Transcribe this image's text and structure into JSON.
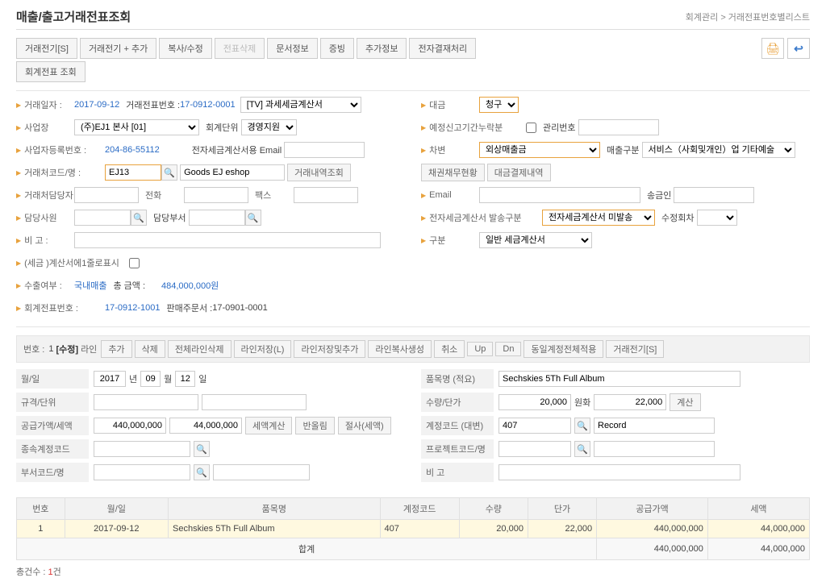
{
  "header": {
    "title": "매출/출고거래전표조회",
    "breadcrumb": "회계관리 > 거래전표번호별리스트"
  },
  "toolbar": {
    "buttons": [
      "거래전기[S]",
      "거래전기 + 추가",
      "복사/수정",
      "전표삭제",
      "문서정보",
      "증빙",
      "추가정보",
      "전자결재처리"
    ],
    "row2": [
      "회계전표 조회"
    ],
    "disabledIdx": 3
  },
  "form": {
    "거래일자_lbl": "거래일자 :",
    "거래일자": "2017-09-12",
    "거래전표번호_lbl": "거래전표번호 :",
    "거래전표번호": "17-0912-0001",
    "docType": "[TV] 과세세금계산서",
    "사업장_lbl": "사업장",
    "사업장": "(주)EJ1 본사 [01]",
    "회계단위_lbl": "회계단위",
    "회계단위": "경영지원",
    "사업자등록번호_lbl": "사업자등록번호 :",
    "사업자등록번호": "204-86-55112",
    "전자세금계산서용Email_lbl": "전자세금계산서용 Email",
    "거래처코드명_lbl": "거래처코드/명 :",
    "거래처코드": "EJ13",
    "거래처명": "Goods EJ eshop",
    "거래내역조회_btn": "거래내역조회",
    "거래처담당자_lbl": "거래처담당자",
    "전화_lbl": "전화",
    "팩스_lbl": "팩스",
    "담당사원_lbl": "담당사원",
    "담당부서_lbl": "담당부서",
    "비고_lbl": "비 고 :",
    "세금계산서표시_lbl": "(세금 )계산서에1줄로표시",
    "수출여부_lbl": "수출여부 :",
    "수출여부": "국내매출",
    "총금액_lbl": "총 금액 :",
    "총금액": "484,000,000원",
    "회계전표번호_lbl": "회계전표번호 :",
    "회계전표번호": "17-0912-1001",
    "판매주문서_lbl": "판매주문서 :",
    "판매주문서": "17-0901-0001",
    "대금_lbl": "대금",
    "대금": "청구",
    "예정신고기간누락분_lbl": "예정신고기간누락분",
    "관리번호_lbl": "관리번호",
    "차변_lbl": "차변",
    "차변": "외상매출금",
    "매출구분_lbl": "매출구분",
    "매출구분": "서비스（사회및개인）업  기타예술",
    "채권채무현황_btn": "채권채무현황",
    "대금결제내역_btn": "대금결제내역",
    "Email_lbl": "Email",
    "송금인_lbl": "송금인",
    "전자세금계산서발송구분_lbl": "전자세금계산서 발송구분",
    "전자발송": "전자세금계산서 미발송",
    "수정회차_lbl": "수정회차",
    "구분_lbl": "구분",
    "구분": "일반 세금계산서"
  },
  "section": {
    "번호_lbl": "번호 :",
    "번호": "1",
    "수정": "[수정]",
    "라인_lbl": "라인",
    "buttons": [
      "추가",
      "삭제",
      "전체라인삭제",
      "라인저장(L)",
      "라인저장및추가",
      "라인복사생성",
      "취소",
      "Up",
      "Dn",
      "동일계정전체적용",
      "거래전기[S]"
    ]
  },
  "detail": {
    "월일_lbl": "월/일",
    "년": "2017",
    "년_suf": "년",
    "월": "09",
    "월_suf": "월",
    "일": "12",
    "일_suf": "일",
    "규격단위_lbl": "규격/단위",
    "공급가액세액_lbl": "공급가액/세액",
    "공급가액": "440,000,000",
    "세액": "44,000,000",
    "세액계산_btn": "세액계산",
    "반올림_btn": "반올림",
    "절사_btn": "절사(세액)",
    "종속계정코드_lbl": "종속계정코드",
    "부서코드명_lbl": "부서코드/명",
    "품목명_lbl": "품목명 (적요)",
    "품목명": "Sechskies 5Th Full Album",
    "수량단가_lbl": "수량/단가",
    "수량": "20,000",
    "원화_lbl": "원화",
    "단가": "22,000",
    "계산_btn": "계산",
    "계정코드_lbl": "계정코드 (대변)",
    "계정코드": "407",
    "계정명": "Record",
    "프로젝트코드명_lbl": "프로젝트코드/명",
    "비고_lbl": "비 고"
  },
  "table": {
    "headers": [
      "번호",
      "월/일",
      "품목명",
      "계정코드",
      "수량",
      "단가",
      "공급가액",
      "세액"
    ],
    "rows": [
      {
        "no": "1",
        "date": "2017-09-12",
        "item": "Sechskies 5Th Full Album",
        "acct": "407",
        "qty": "20,000",
        "price": "22,000",
        "supply": "440,000,000",
        "tax": "44,000,000"
      }
    ],
    "total_lbl": "합계",
    "total_supply": "440,000,000",
    "total_tax": "44,000,000"
  },
  "footer": {
    "총건수_lbl": "총건수 :",
    "총건수": "1",
    "건": "건"
  }
}
